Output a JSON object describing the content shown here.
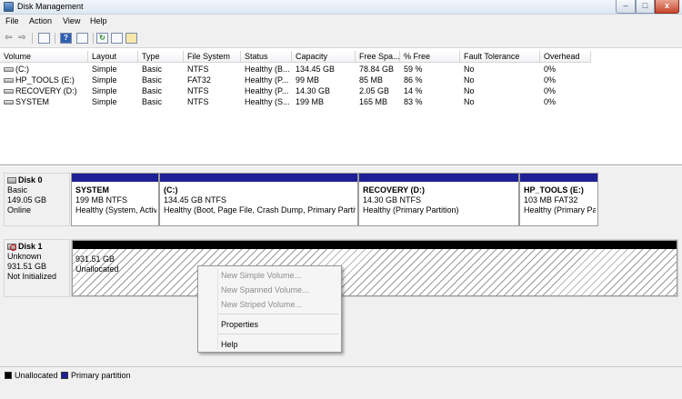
{
  "window": {
    "title": "Disk Management",
    "controls": [
      "–",
      "□",
      "x"
    ]
  },
  "menu": [
    "File",
    "Action",
    "View",
    "Help"
  ],
  "toolbar": {
    "back": "⇦",
    "forward": "⇨"
  },
  "volumes": {
    "headers": [
      "Volume",
      "Layout",
      "Type",
      "File System",
      "Status",
      "Capacity",
      "Free Spa...",
      "% Free",
      "Fault Tolerance",
      "Overhead"
    ],
    "rows": [
      [
        "(C:)",
        "Simple",
        "Basic",
        "NTFS",
        "Healthy (B...",
        "134.45 GB",
        "78.84 GB",
        "59 %",
        "No",
        "0%"
      ],
      [
        "HP_TOOLS (E:)",
        "Simple",
        "Basic",
        "FAT32",
        "Healthy (P...",
        "99 MB",
        "85 MB",
        "86 %",
        "No",
        "0%"
      ],
      [
        "RECOVERY (D:)",
        "Simple",
        "Basic",
        "NTFS",
        "Healthy (P...",
        "14.30 GB",
        "2.05 GB",
        "14 %",
        "No",
        "0%"
      ],
      [
        "SYSTEM",
        "Simple",
        "Basic",
        "NTFS",
        "Healthy (S...",
        "199 MB",
        "165 MB",
        "83 %",
        "No",
        "0%"
      ]
    ]
  },
  "disks": [
    {
      "name": "Disk 0",
      "type": "Basic",
      "size": "149.05 GB",
      "status": "Online",
      "partitions": [
        {
          "name": "SYSTEM",
          "size": "199 MB NTFS",
          "status": "Healthy (System, Activ"
        },
        {
          "name": "(C:)",
          "size": "134.45 GB NTFS",
          "status": "Healthy (Boot, Page File, Crash Dump, Primary Partitio"
        },
        {
          "name": "RECOVERY  (D:)",
          "size": "14.30 GB NTFS",
          "status": "Healthy (Primary Partition)"
        },
        {
          "name": "HP_TOOLS  (E:)",
          "size": "103 MB FAT32",
          "status": "Healthy (Primary Pa"
        }
      ]
    },
    {
      "name": "Disk 1",
      "type": "Unknown",
      "size": "931.51 GB",
      "status": "Not Initialized",
      "unallocated": {
        "size": "931.51 GB",
        "label": "Unallocated"
      }
    }
  ],
  "context_menu": {
    "items": [
      {
        "label": "New Simple Volume...",
        "enabled": false
      },
      {
        "label": "New Spanned Volume...",
        "enabled": false
      },
      {
        "label": "New Striped Volume...",
        "enabled": false
      },
      {
        "label": "Properties",
        "enabled": true
      },
      {
        "label": "Help",
        "enabled": true
      }
    ]
  },
  "legend": [
    {
      "label": "Unallocated",
      "color": "#000000"
    },
    {
      "label": "Primary partition",
      "color": "#1f1f96"
    }
  ]
}
